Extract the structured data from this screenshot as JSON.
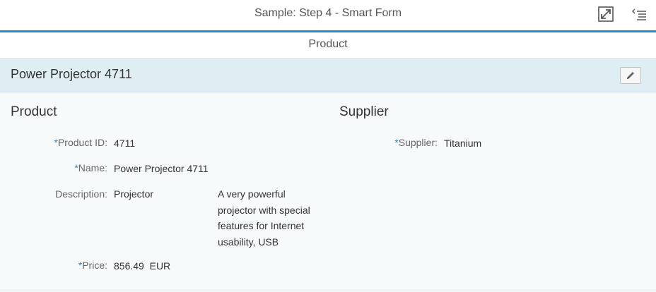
{
  "shell": {
    "title": "Sample: Step 4 - Smart Form",
    "icons": [
      "fullscreen-icon",
      "menu-list-icon"
    ]
  },
  "page": {
    "subtitle": "Product"
  },
  "form": {
    "title": "Power Projector 4711",
    "edit_icon": "pencil-icon",
    "groups": {
      "product": {
        "title": "Product",
        "fields": {
          "product_id": {
            "label": "Product ID:",
            "required": "*",
            "value": "4711"
          },
          "name": {
            "label": "Name:",
            "required": "*",
            "value": "Power Projector 4711"
          },
          "description": {
            "label": "Description:",
            "value": "Projector",
            "long_text": "A very powerful projector with special features for Internet usability, USB"
          },
          "price": {
            "label": "Price:",
            "required": "*",
            "value": "856.49",
            "currency": "EUR"
          }
        }
      },
      "supplier": {
        "title": "Supplier",
        "fields": {
          "supplier": {
            "label": "Supplier:",
            "required": "*",
            "value": "Titanium"
          }
        }
      }
    }
  },
  "colors": {
    "accent": "#1a8ed1",
    "toolbar_bg": "#dfeef3",
    "page_bg": "#f7fafb"
  }
}
